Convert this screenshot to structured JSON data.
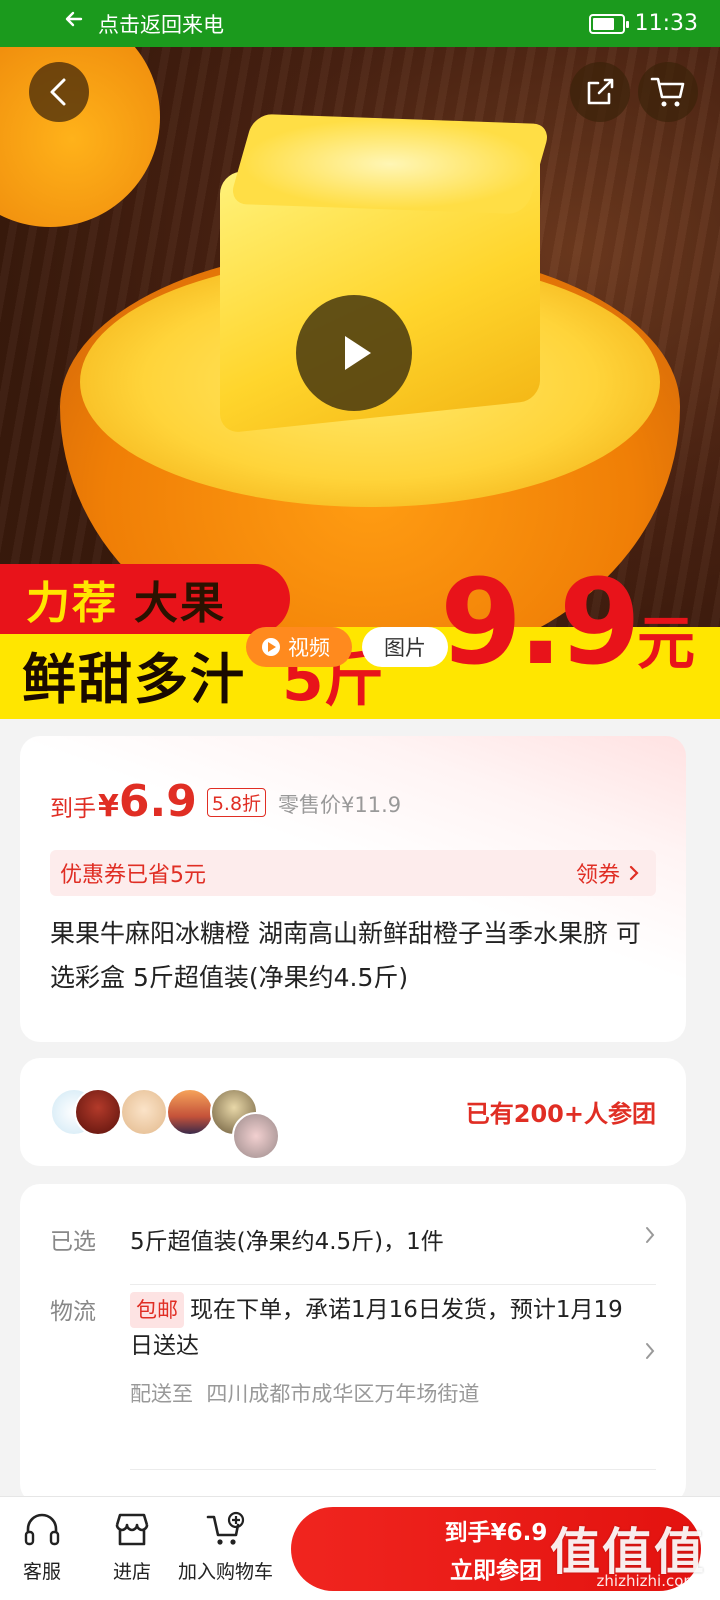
{
  "status_bar": {
    "back_call_text": "点击返回来电",
    "time": "11:33",
    "battery_level": 0.75
  },
  "hero": {
    "banner_tag_1": "力荐",
    "banner_tag_2": "大果",
    "slogan": "鲜甜多汁",
    "weight": "5斤",
    "big_price": "9.9",
    "big_price_unit": "元",
    "media_tabs": [
      "视频",
      "图片"
    ]
  },
  "price": {
    "prefix": "到手",
    "currency": "¥",
    "amount": "6.9",
    "discount": "5.8折",
    "retail": "零售价¥11.9"
  },
  "coupon": {
    "text": "优惠券已省5元",
    "action": "领券"
  },
  "product_title": "果果牛麻阳冰糖橙 湖南高山新鲜甜橙子当季水果脐 可选彩盒 5斤超值装(净果约4.5斤)",
  "group": {
    "text": "已有200+人参团"
  },
  "selection": {
    "label": "已选",
    "value": "5斤超值装(净果约4.5斤)，1件"
  },
  "logistics": {
    "label": "物流",
    "tag": "包邮",
    "text": "现在下单，承诺1月16日发货，预计1月19日送达",
    "ship_to_label": "配送至",
    "ship_to": "四川成都市成华区万年场街道"
  },
  "bottom_bar": {
    "service": "客服",
    "store": "进店",
    "add_cart": "加入购物车",
    "buy_line1": "到手¥6.9",
    "buy_line2": "立即参团"
  },
  "watermark": {
    "main": "值值值",
    "sub": "zhizhizhi.com"
  },
  "colors": {
    "accent": "#e02e24",
    "status_bar": "#1b9a1d",
    "banner_yellow": "#ffe600"
  }
}
